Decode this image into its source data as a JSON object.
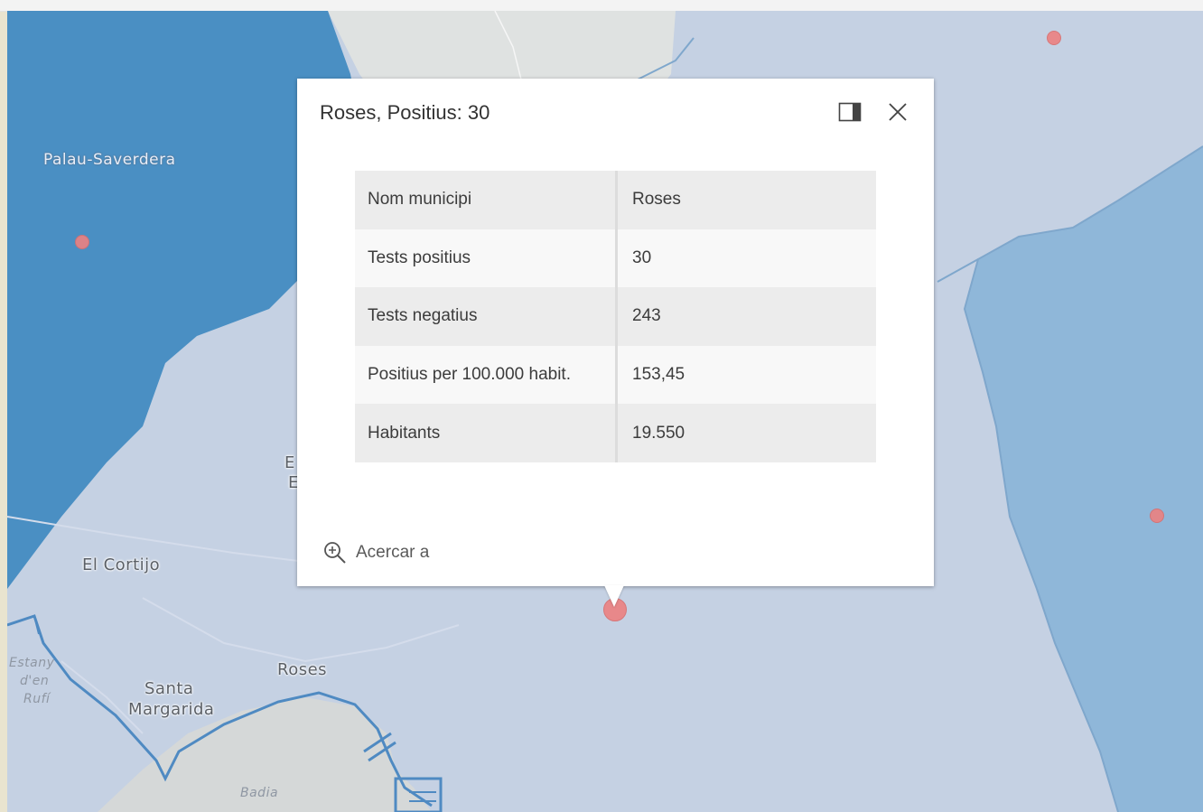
{
  "map": {
    "labels": {
      "palau": "Palau-Saverdera",
      "cortijo": "El Cortijo",
      "roses": "Roses",
      "santa_margarida": [
        "Santa",
        "Margarida"
      ],
      "estany": [
        "Estany",
        "d'en",
        "Rufí"
      ],
      "badia": "Badia",
      "partial": [
        "E",
        "E"
      ]
    },
    "colors": {
      "background": "#c5d1e3",
      "dark_blue": "#4a8fc3",
      "mid_blue": "#8fb7d9",
      "land_gray": "#dfe2e1",
      "marker": "#ec8181"
    },
    "marker_icon": "circle-marker-icon"
  },
  "popup": {
    "title": "Roses, Positius: 30",
    "dock_icon": "dock-panel-icon",
    "close_icon": "close-icon",
    "rows": [
      {
        "label": "Nom municipi",
        "value": "Roses"
      },
      {
        "label": "Tests positius",
        "value": "30"
      },
      {
        "label": "Tests negatius",
        "value": "243"
      },
      {
        "label": "Positius per 100.000 habit.",
        "value": "153,45"
      },
      {
        "label": "Habitants",
        "value": "19.550"
      }
    ],
    "zoom_icon": "zoom-in-icon",
    "zoom_label": "Acercar a"
  }
}
